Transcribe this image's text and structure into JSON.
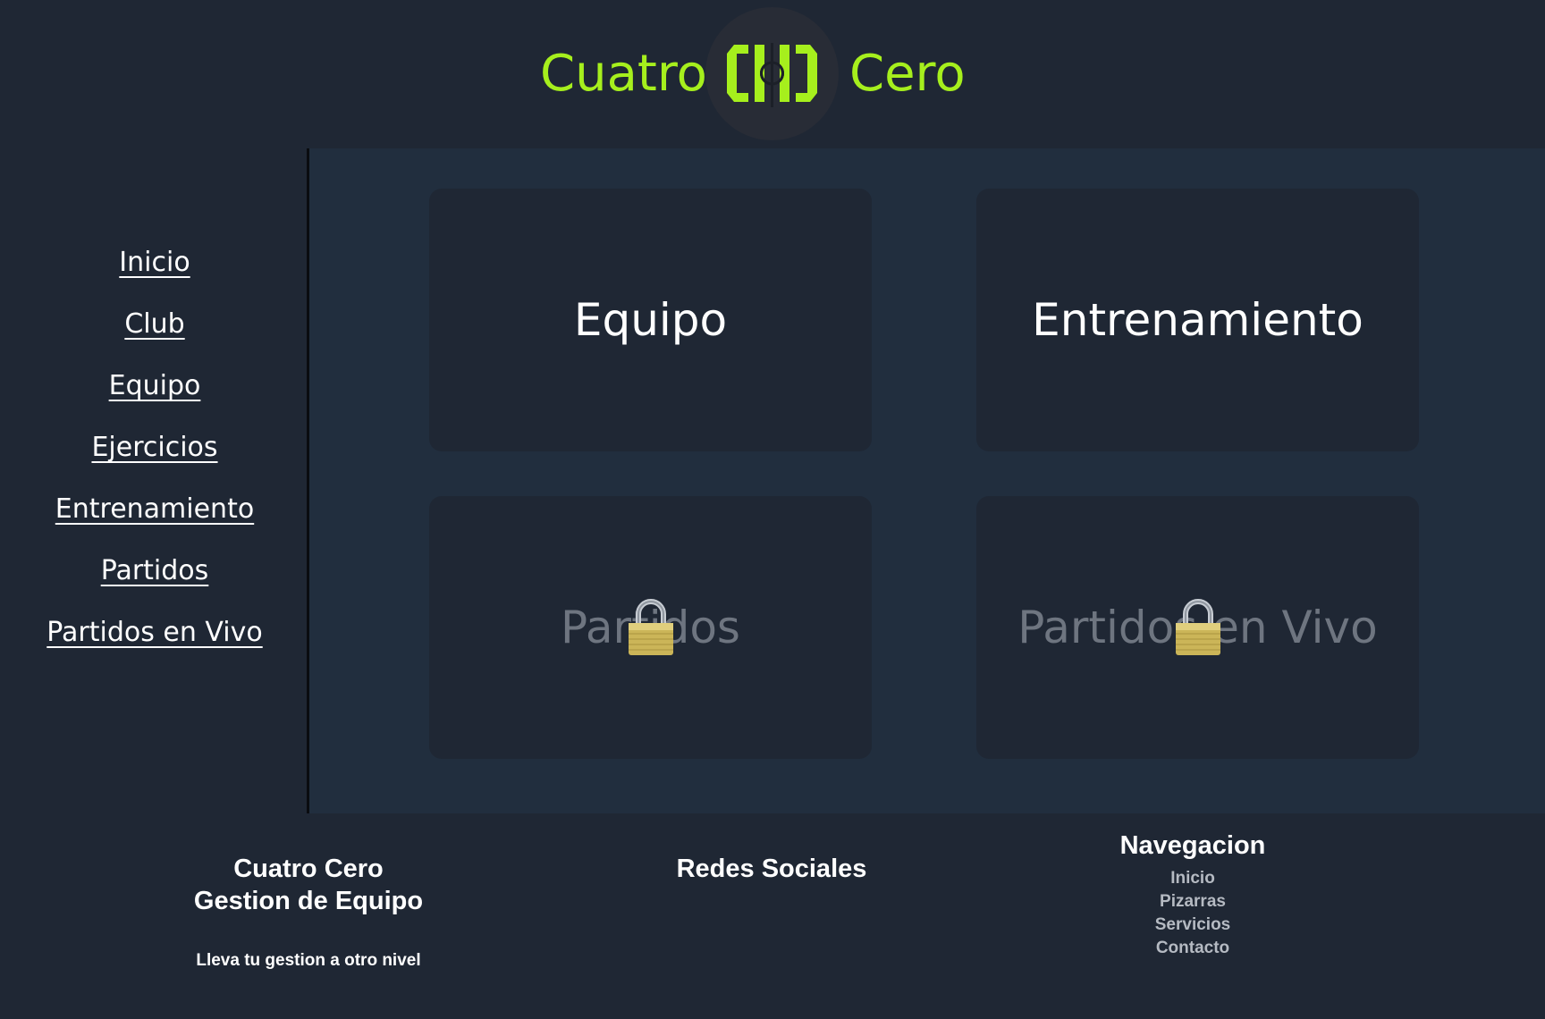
{
  "header": {
    "brand_left": "Cuatro",
    "brand_right": "Cero",
    "brand_color": "#a6ef1d"
  },
  "sidebar": {
    "items": [
      {
        "label": "Inicio"
      },
      {
        "label": "Club"
      },
      {
        "label": "Equipo"
      },
      {
        "label": "Ejercicios"
      },
      {
        "label": "Entrenamiento"
      },
      {
        "label": "Partidos"
      },
      {
        "label": "Partidos en Vivo"
      }
    ]
  },
  "cards": [
    {
      "title": "Equipo",
      "locked": false,
      "icon": "none"
    },
    {
      "title": "Entrenamiento",
      "locked": false,
      "icon": "none"
    },
    {
      "title": "Partidos",
      "locked": true,
      "icon": "padlock-icon"
    },
    {
      "title": "Partidos en Vivo",
      "locked": true,
      "icon": "padlock-icon"
    }
  ],
  "footer": {
    "brand": {
      "line1": "Cuatro Cero",
      "line2": "Gestion de Equipo",
      "tagline": "Lleva tu gestion a otro nivel"
    },
    "social": {
      "heading": "Redes Sociales"
    },
    "navigation": {
      "heading": "Navegacion",
      "links": [
        "Inicio",
        "Pizarras",
        "Servicios",
        "Contacto"
      ]
    }
  },
  "colors": {
    "background": "#1f2734",
    "main_panel": "#212e3e",
    "card": "#1f2734",
    "locked_text": "#6e7580",
    "accent": "#a6ef1d"
  }
}
